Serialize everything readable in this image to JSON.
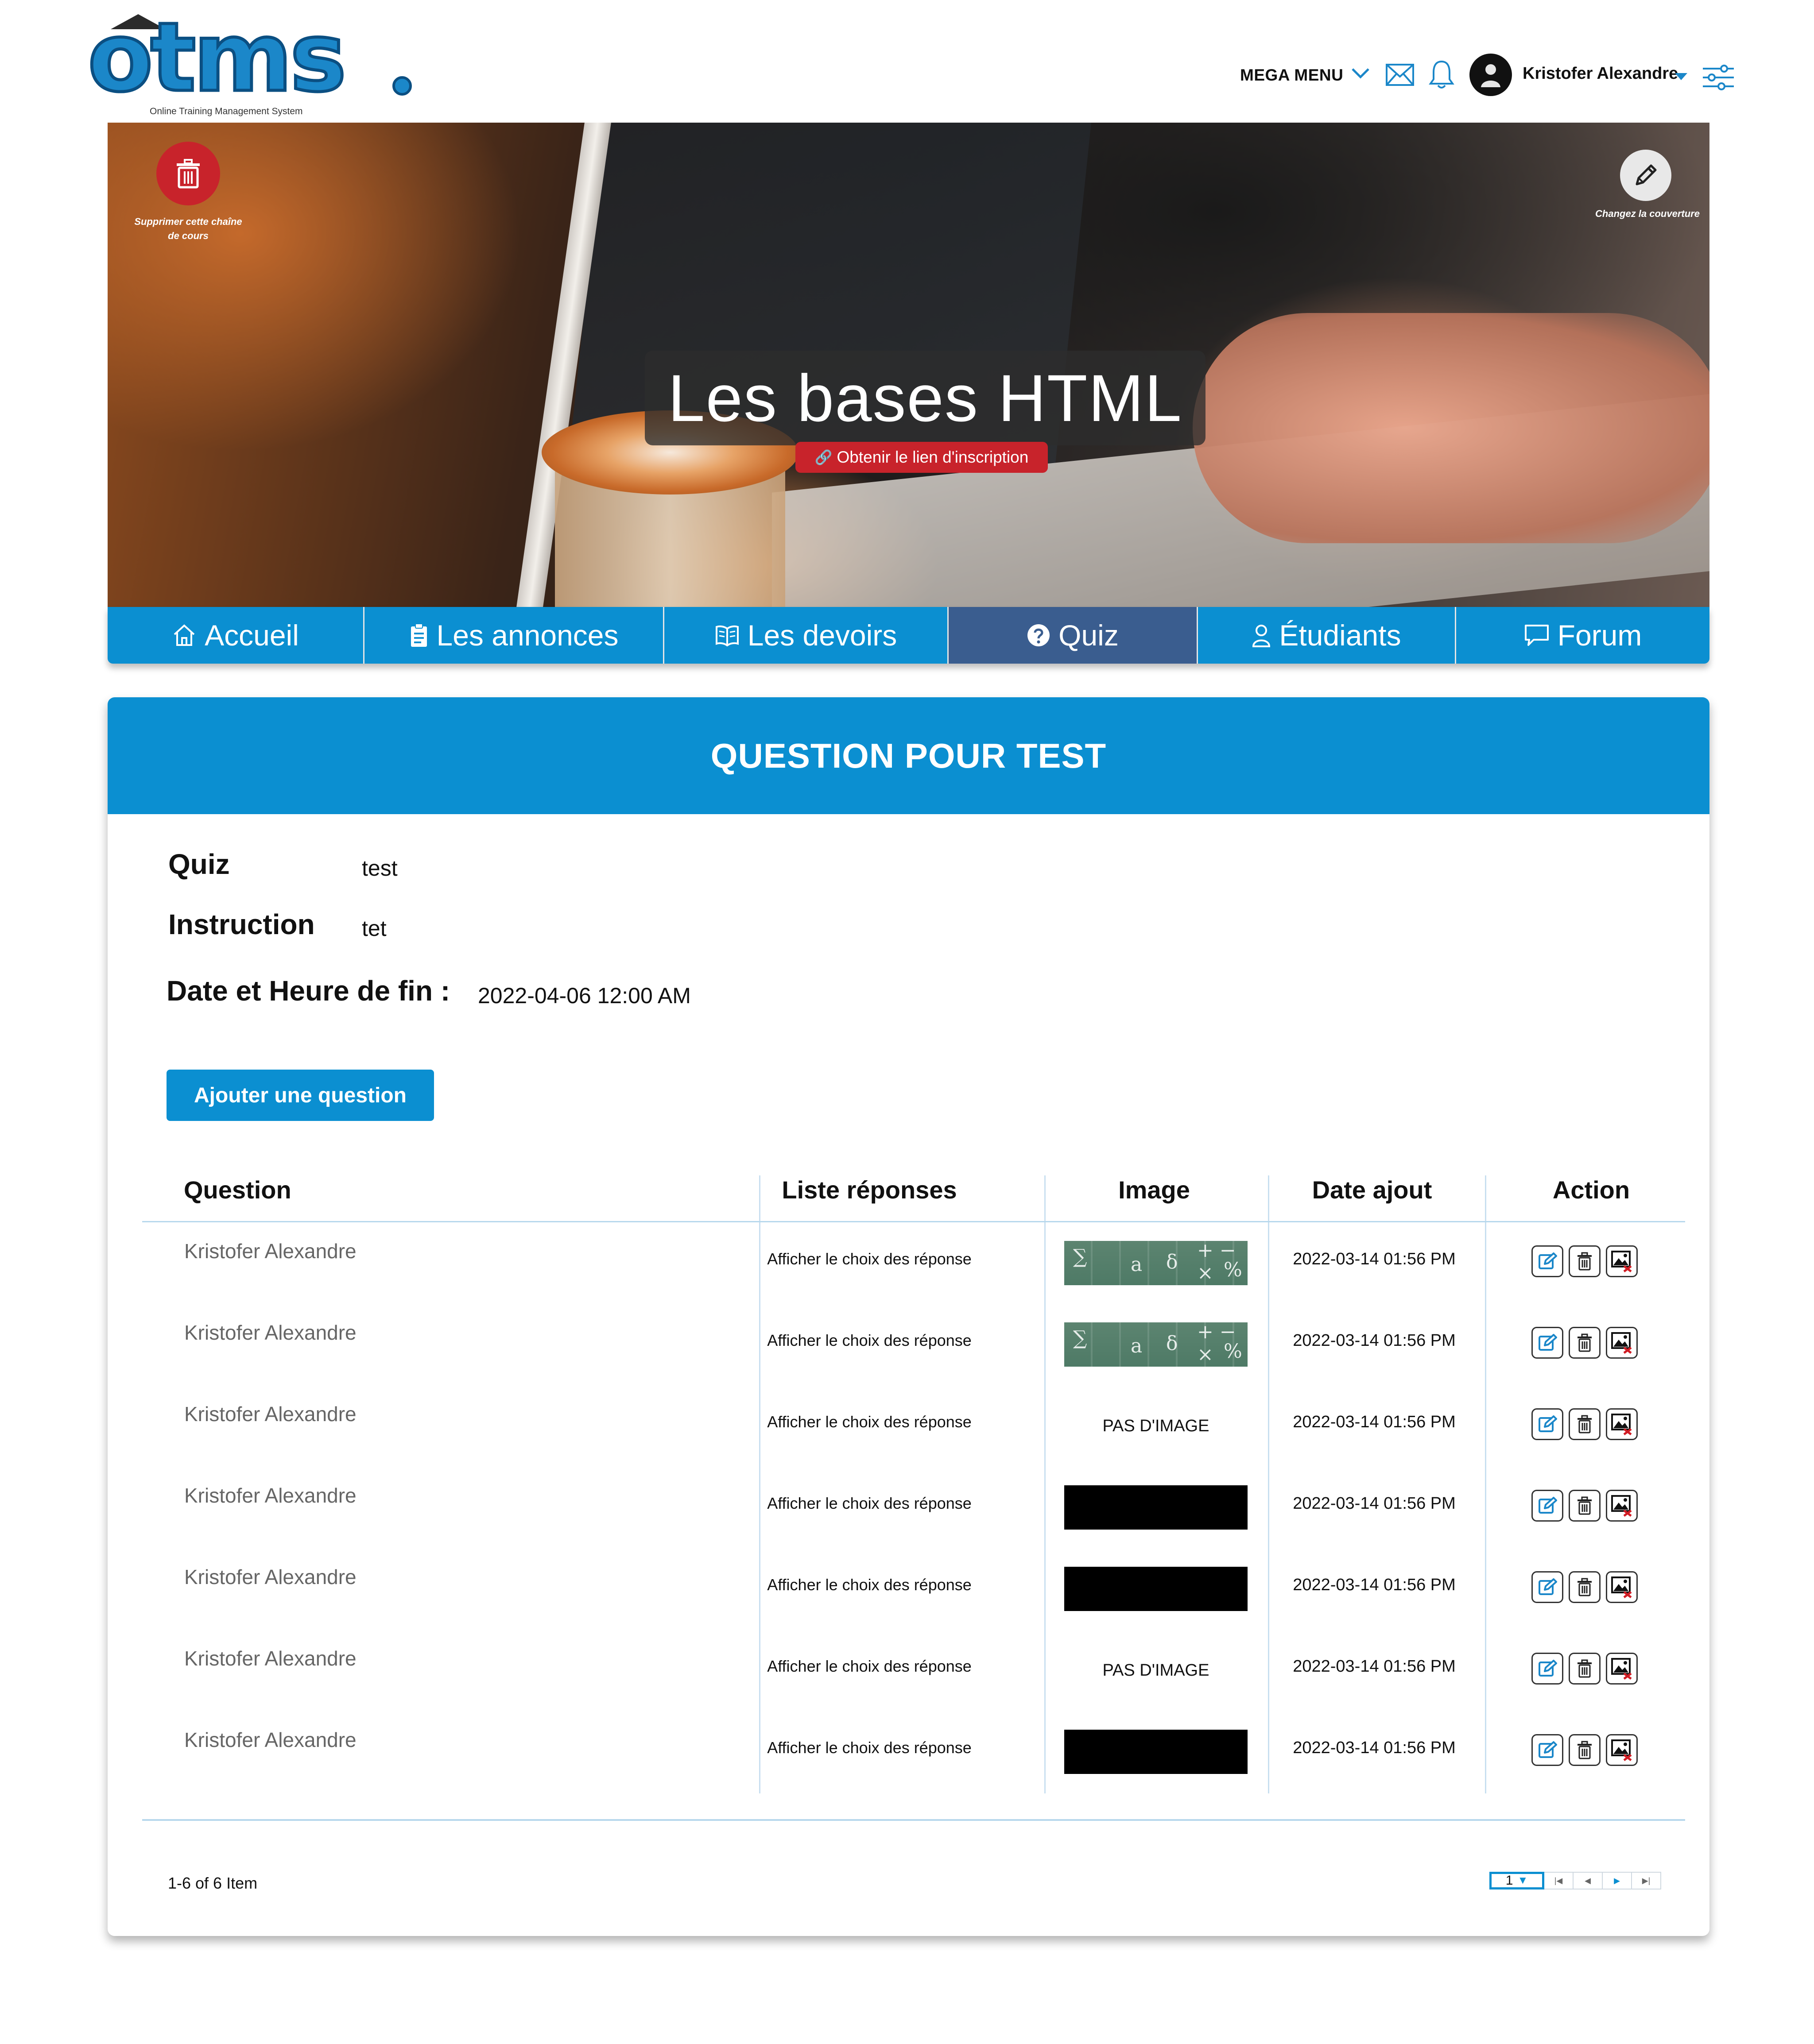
{
  "brand": {
    "logo_text": "otms",
    "tagline": "Online Training Management System"
  },
  "topbar": {
    "mega_menu": "MEGA MENU",
    "user_name": "Kristofer Alexandre",
    "icons": [
      "chevron-down-icon",
      "mail-icon",
      "bell-icon",
      "avatar",
      "caret-down-icon",
      "sliders-icon"
    ]
  },
  "hero": {
    "delete_label": "Supprimer cette chaîne de cours",
    "cover_label": "Changez la couverture",
    "course_title": "Les bases HTML",
    "link_button": "Obtenir le lien d'inscription"
  },
  "tabs": [
    {
      "label": "Accueil",
      "icon": "home-icon",
      "active": false
    },
    {
      "label": "Les annonces",
      "icon": "clipboard-icon",
      "active": false
    },
    {
      "label": "Les devoirs",
      "icon": "book-icon",
      "active": false
    },
    {
      "label": "Quiz",
      "icon": "question-circle-icon",
      "active": true
    },
    {
      "label": "Étudiants",
      "icon": "user-icon",
      "active": false
    },
    {
      "label": "Forum",
      "icon": "chat-icon",
      "active": false
    }
  ],
  "card": {
    "title": "QUESTION POUR TEST",
    "quiz_label": "Quiz",
    "quiz_value": "test",
    "instruction_label": "Instruction",
    "instruction_value": "tet",
    "end_label": "Date et Heure de fin :",
    "end_value": "2022-04-06 12:00 AM",
    "add_button": "Ajouter une question"
  },
  "table": {
    "headers": {
      "question": "Question",
      "answers": "Liste réponses",
      "image": "Image",
      "date": "Date ajout",
      "action": "Action"
    },
    "rows": [
      {
        "question": "Kristofer Alexandre",
        "answers": "Afficher le choix des réponse",
        "image": "chalkboard",
        "image_text": "",
        "date": "2022-03-14 01:56 PM"
      },
      {
        "question": "Kristofer Alexandre",
        "answers": "Afficher le choix des réponse",
        "image": "chalkboard",
        "image_text": "",
        "date": "2022-03-14 01:56 PM"
      },
      {
        "question": "Kristofer Alexandre",
        "answers": "Afficher le choix des réponse",
        "image": "none",
        "image_text": "PAS D'IMAGE",
        "date": "2022-03-14 01:56 PM"
      },
      {
        "question": "Kristofer Alexandre",
        "answers": "Afficher le choix des réponse",
        "image": "black",
        "image_text": "",
        "date": "2022-03-14 01:56 PM"
      },
      {
        "question": "Kristofer Alexandre",
        "answers": "Afficher le choix des réponse",
        "image": "black",
        "image_text": "",
        "date": "2022-03-14 01:56 PM"
      },
      {
        "question": "Kristofer Alexandre",
        "answers": "Afficher le choix des réponse",
        "image": "none",
        "image_text": "PAS D'IMAGE",
        "date": "2022-03-14 01:56 PM"
      },
      {
        "question": "Kristofer Alexandre",
        "answers": "Afficher le choix des réponse",
        "image": "black",
        "image_text": "",
        "date": "2022-03-14 01:56 PM"
      }
    ],
    "actions": [
      "edit-icon",
      "trash-icon",
      "remove-image-icon"
    ]
  },
  "pagination": {
    "summary": "1-6 of 6 Item",
    "page": "1",
    "buttons": [
      "first-page-icon",
      "prev-page-icon",
      "next-page-icon",
      "last-page-icon"
    ]
  },
  "colors": {
    "primary": "#0b8fd1",
    "tab_active": "#3a5d8f",
    "danger": "#c8232b",
    "logo_blue": "#1b87c9"
  }
}
